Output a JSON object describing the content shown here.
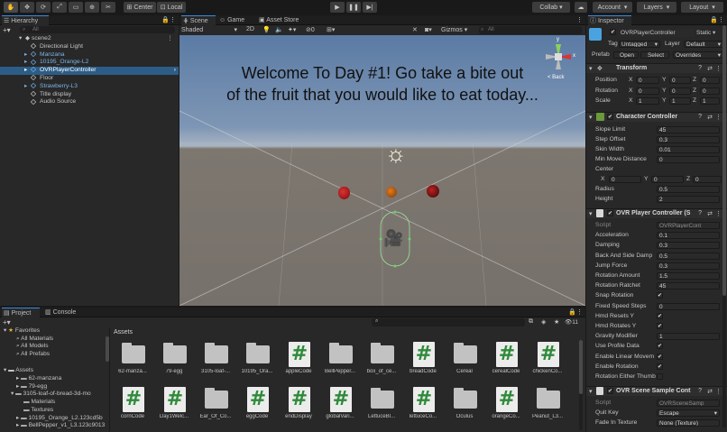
{
  "toolbar": {
    "pivot": "Center",
    "space": "Local",
    "collab": "Collab ▾",
    "account": "Account",
    "layers": "Layers",
    "layout": "Layout"
  },
  "hierarchy": {
    "tab": "Hierarchy",
    "search_placeholder": "All",
    "items": [
      {
        "label": "scene2"
      },
      {
        "label": "Directional Light"
      },
      {
        "label": "Manzana"
      },
      {
        "label": "10195_Orange-L2"
      },
      {
        "label": "OVRPlayerController"
      },
      {
        "label": "Floor"
      },
      {
        "label": "Strawberry-L3"
      },
      {
        "label": "Title display"
      },
      {
        "label": "Audio Source"
      }
    ]
  },
  "scene": {
    "tabs": [
      "Scene",
      "Game",
      "Asset Store"
    ],
    "shading": "Shaded",
    "mode": "2D",
    "layer_count": "0",
    "gizmos": "Gizmos",
    "search_placeholder": "All",
    "back_label": "< Back",
    "title_text_line1": "Welcome To Day #1!  Go take a bite out",
    "title_text_line2": "of the fruit that you would like to eat today...",
    "axis_y": "y",
    "axis_x": "x",
    "axis_z": "z"
  },
  "inspector": {
    "tab": "Inspector",
    "object_name": "OVRPlayerController",
    "static": "Static ▾",
    "tag_label": "Tag",
    "tag_value": "Untagged",
    "layer_label": "Layer",
    "layer_value": "Default",
    "prefab_label": "Prefab",
    "prefab_open": "Open",
    "prefab_select": "Select",
    "prefab_overrides": "Overrides",
    "transform": {
      "title": "Transform",
      "rows": [
        {
          "label": "Position",
          "x": "0",
          "y": "0",
          "z": "0"
        },
        {
          "label": "Rotation",
          "x": "0",
          "y": "0",
          "z": "0"
        },
        {
          "label": "Scale",
          "x": "1",
          "y": "1",
          "z": "1"
        }
      ]
    },
    "character_controller": {
      "title": "Character Controller",
      "slope_limit_label": "Slope Limit",
      "slope_limit": "45",
      "step_offset_label": "Step Offset",
      "step_offset": "0.3",
      "skin_width_label": "Skin Width",
      "skin_width": "0.01",
      "min_move_label": "Min Move Distance",
      "min_move": "0",
      "center_label": "Center",
      "cx": "0",
      "cy": "0",
      "cz": "0",
      "radius_label": "Radius",
      "radius": "0.5",
      "height_label": "Height",
      "height": "2"
    },
    "ovr_player": {
      "title": "OVR Player Controller (S",
      "script_label": "Script",
      "script_value": "OVRPlayerCont",
      "acceleration_label": "Acceleration",
      "acceleration": "0.1",
      "damping_label": "Damping",
      "damping": "0.3",
      "back_side_label": "Back And Side Damp",
      "back_side": "0.5",
      "jump_label": "Jump Force",
      "jump": "0.3",
      "rot_amount_label": "Rotation Amount",
      "rot_amount": "1.5",
      "rot_ratchet_label": "Rotation Ratchet",
      "rot_ratchet": "45",
      "snap_label": "Snap Rotation",
      "fixed_speed_label": "Fixed Speed Steps",
      "fixed_speed": "0",
      "hmd_resets_label": "Hmd Resets Y",
      "hmd_rotates_label": "Hmd Rotates Y",
      "gravity_label": "Gravity Modifier",
      "gravity": "1",
      "profile_label": "Use Profile Data",
      "enable_linear_label": "Enable Linear Movem",
      "enable_rotation_label": "Enable Rotation",
      "rotation_either_label": "Rotation Either Thumb"
    },
    "ovr_scene_sample": {
      "title": "OVR Scene Sample Cont",
      "script_label": "Script",
      "script_value": "OVRSceneSamp",
      "quit_key_label": "Quit Key",
      "quit_key": "Escape",
      "fade_label": "Fade In Texture",
      "fade": "None (Texture)"
    }
  },
  "project": {
    "tabs": [
      "Project",
      "Console"
    ],
    "favorites_label": "Favorites",
    "favorites": [
      "All Materials",
      "All Models",
      "All Prefabs"
    ],
    "assets_label": "Assets",
    "tree": [
      "62-manzana",
      "79-egg",
      "3105-loaf-of-bread-3d-mo",
      "Materials",
      "Textures",
      "10195_Orange_L2.123cd5b",
      "BellPepper_v1_L3.123c9013"
    ],
    "count_badge": "11",
    "breadcrumb": "Assets",
    "assets_row1": [
      {
        "name": "62-manza...",
        "kind": "folder"
      },
      {
        "name": "79-egg",
        "kind": "folder"
      },
      {
        "name": "3105-loaf-...",
        "kind": "folder"
      },
      {
        "name": "10195_Ora...",
        "kind": "folder"
      },
      {
        "name": "appleCode",
        "kind": "script"
      },
      {
        "name": "BellPepper...",
        "kind": "folder"
      },
      {
        "name": "box_of_ce...",
        "kind": "folder"
      },
      {
        "name": "breadCode",
        "kind": "script"
      },
      {
        "name": "Cereal",
        "kind": "folder"
      },
      {
        "name": "cerealCode",
        "kind": "script"
      },
      {
        "name": "chickenCo...",
        "kind": "script"
      }
    ],
    "assets_row2": [
      {
        "name": "cornCode",
        "kind": "script"
      },
      {
        "name": "Day1Welc...",
        "kind": "script"
      },
      {
        "name": "Ear_Of_Co...",
        "kind": "folder"
      },
      {
        "name": "eggCode",
        "kind": "script"
      },
      {
        "name": "endDisplay",
        "kind": "script"
      },
      {
        "name": "globalVari...",
        "kind": "script"
      },
      {
        "name": "LettuceBl...",
        "kind": "folder"
      },
      {
        "name": "lettuceCo...",
        "kind": "script"
      },
      {
        "name": "Oculus",
        "kind": "folder"
      },
      {
        "name": "orangeCo...",
        "kind": "script"
      },
      {
        "name": "Peanut_L3...",
        "kind": "folder"
      }
    ]
  }
}
